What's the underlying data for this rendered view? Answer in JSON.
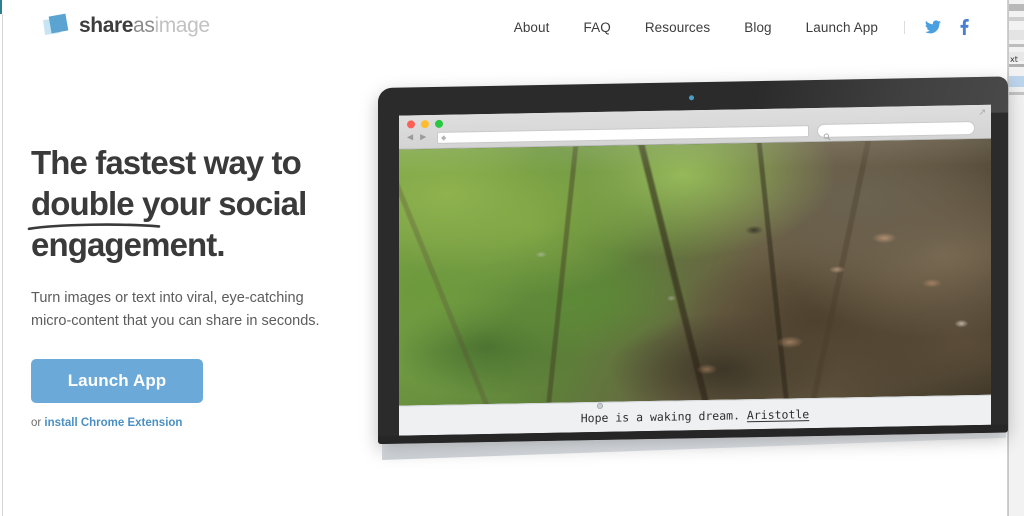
{
  "header": {
    "logo": {
      "part1": "share",
      "part2": "as",
      "part3": "image",
      "mark_color_back": "#c6e4f2",
      "mark_color_front": "#5ba3d0"
    },
    "nav_items": [
      {
        "label": "About"
      },
      {
        "label": "FAQ"
      },
      {
        "label": "Resources"
      },
      {
        "label": "Blog"
      },
      {
        "label": "Launch App"
      }
    ],
    "social": [
      {
        "name": "twitter",
        "color": "#4a9fe0"
      },
      {
        "name": "facebook",
        "color": "#4a7fd0"
      }
    ]
  },
  "hero": {
    "headline_line1": "The fastest way to",
    "headline_underlined_word": "double",
    "headline_line2_rest": " your social",
    "headline_line3": "engagement.",
    "subhead_line1": "Turn images or text into viral, eye-catching",
    "subhead_line2": "micro-content that you can share in seconds.",
    "cta_label": "Launch App",
    "cta_color": "#6aa9d8",
    "cta_sub_prefix": "or ",
    "cta_sub_link": "install Chrome Extension",
    "cta_sub_link_color": "#4a90c4"
  },
  "mockup": {
    "browser": {
      "traffic_lights": [
        "#ff5f57",
        "#febc2e",
        "#28c840"
      ],
      "back_glyph": "◀",
      "forward_glyph": "▶",
      "address_value": "",
      "address_placeholder": "",
      "search_value": "",
      "search_placeholder": ""
    },
    "caption": {
      "quote": "Hope is a waking dream. ",
      "author": "Aristotle"
    },
    "photo_alt": "forest floor with green moss and brown leaves"
  }
}
